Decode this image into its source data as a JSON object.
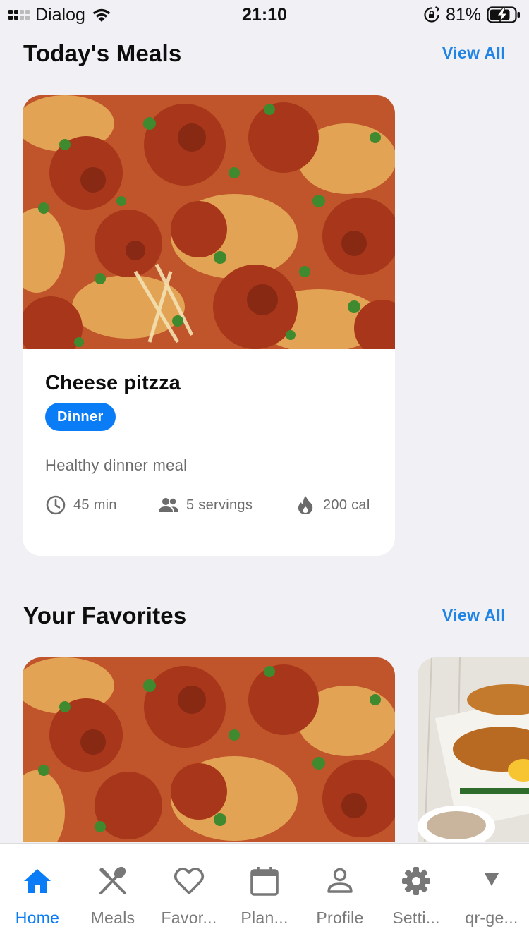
{
  "status_bar": {
    "carrier": "Dialog",
    "time": "21:10",
    "battery_percent": "81%"
  },
  "todays_meals": {
    "title": "Today's Meals",
    "view_all_label": "View All",
    "meal": {
      "name": "Cheese pitzza",
      "category": "Dinner",
      "description": "Healthy dinner meal",
      "time": "45 min",
      "servings": "5 servings",
      "calories": "200 cal",
      "image": "pizza-photo"
    }
  },
  "favorites": {
    "title": "Your Favorites",
    "view_all_label": "View All",
    "items": [
      {
        "image": "pizza-photo"
      },
      {
        "image": "croissant-photo"
      }
    ]
  },
  "tab_bar": {
    "active": "Home",
    "tabs": [
      {
        "label": "Home",
        "icon": "home-icon"
      },
      {
        "label": "Meals",
        "icon": "utensils-icon"
      },
      {
        "label": "Favor...",
        "icon": "heart-icon"
      },
      {
        "label": "Plan...",
        "icon": "calendar-icon"
      },
      {
        "label": "Profile",
        "icon": "person-icon"
      },
      {
        "label": "Setti...",
        "icon": "gear-icon"
      },
      {
        "label": "qr-ge...",
        "icon": "triangle-down-icon"
      }
    ]
  },
  "colors": {
    "accent": "#0a7cf6",
    "link": "#1f84e6",
    "background": "#f1f0f5",
    "muted_text": "#6b6b6b"
  }
}
